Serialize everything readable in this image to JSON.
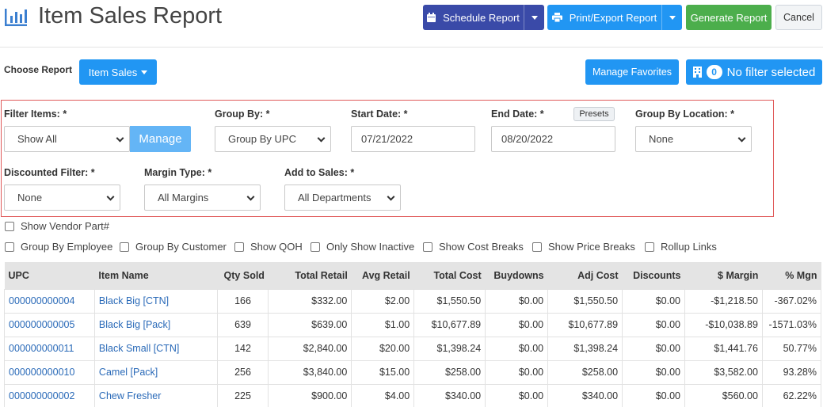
{
  "header": {
    "title": "Item Sales Report",
    "icon": "bar-chart-icon",
    "schedule_label": "Schedule Report",
    "print_label": "Print/Export Report",
    "generate_label": "Generate Report",
    "cancel_label": "Cancel"
  },
  "report_chooser": {
    "label": "Choose Report",
    "value": "Item Sales",
    "manage_favorites_label": "Manage Favorites",
    "filter_count": "0",
    "filter_text": "No filter selected"
  },
  "filters": {
    "filter_items": {
      "label": "Filter Items: *",
      "value": "Show All",
      "manage_label": "Manage"
    },
    "group_by": {
      "label": "Group By: *",
      "value": "Group By UPC"
    },
    "start_date": {
      "label": "Start Date: *",
      "value": "07/21/2022"
    },
    "end_date": {
      "label": "End Date: *",
      "value": "08/20/2022",
      "presets_label": "Presets"
    },
    "group_by_location": {
      "label": "Group By Location: *",
      "value": "None"
    },
    "discounted_filter": {
      "label": "Discounted Filter: *",
      "value": "None"
    },
    "margin_type": {
      "label": "Margin Type: *",
      "value": "All Margins"
    },
    "add_to_sales": {
      "label": "Add to Sales: *",
      "value": "All Departments"
    }
  },
  "options": {
    "show_vendor_part": "Show Vendor Part#",
    "group_by_employee": "Group By Employee",
    "group_by_customer": "Group By Customer",
    "show_qoh": "Show QOH",
    "only_show_inactive": "Only Show Inactive",
    "show_cost_breaks": "Show Cost Breaks",
    "show_price_breaks": "Show Price Breaks",
    "rollup_links": "Rollup Links"
  },
  "table": {
    "columns": [
      "UPC",
      "Item Name",
      "Qty Sold",
      "Total Retail",
      "Avg Retail",
      "Total Cost",
      "Buydowns",
      "Adj Cost",
      "Discounts",
      "$ Margin",
      "% Mgn"
    ],
    "rows": [
      [
        "000000000004",
        "Black Big [CTN]",
        "166",
        "$332.00",
        "$2.00",
        "$1,550.50",
        "$0.00",
        "$1,550.50",
        "$0.00",
        "-$1,218.50",
        "-367.02%"
      ],
      [
        "000000000005",
        "Black Big [Pack]",
        "639",
        "$639.00",
        "$1.00",
        "$10,677.89",
        "$0.00",
        "$10,677.89",
        "$0.00",
        "-$10,038.89",
        "-1571.03%"
      ],
      [
        "000000000011",
        "Black Small [CTN]",
        "142",
        "$2,840.00",
        "$20.00",
        "$1,398.24",
        "$0.00",
        "$1,398.24",
        "$0.00",
        "$1,441.76",
        "50.77%"
      ],
      [
        "000000000010",
        "Camel [Pack]",
        "256",
        "$3,840.00",
        "$15.00",
        "$258.00",
        "$0.00",
        "$258.00",
        "$0.00",
        "$3,582.00",
        "93.28%"
      ],
      [
        "000000000002",
        "Chew Fresher",
        "225",
        "$900.00",
        "$4.00",
        "$340.00",
        "$0.00",
        "$340.00",
        "$0.00",
        "$560.00",
        "62.22%"
      ]
    ]
  },
  "colors": {
    "navy_button": "#3a4aa8",
    "blue_button": "#2196f3",
    "green_button": "#4cae4c",
    "filter_border": "#e05a5a",
    "link": "#2a6ab8"
  }
}
